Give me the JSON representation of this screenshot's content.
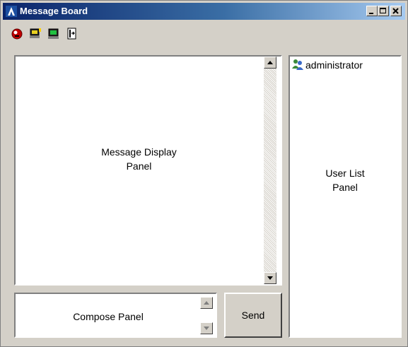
{
  "window": {
    "title": "Message Board",
    "controls": [
      "minimize",
      "maximize",
      "close"
    ]
  },
  "toolbar": {
    "icons": [
      "disconnect-icon",
      "connect-icon",
      "monitor-icon",
      "exit-icon"
    ]
  },
  "message_display": {
    "label_line1": "Message Display",
    "label_line2": "Panel"
  },
  "compose": {
    "label": "Compose Panel"
  },
  "send_button": {
    "label": "Send"
  },
  "user_list": {
    "users": [
      "administrator"
    ],
    "label_line1": "User List",
    "label_line2": "Panel"
  }
}
